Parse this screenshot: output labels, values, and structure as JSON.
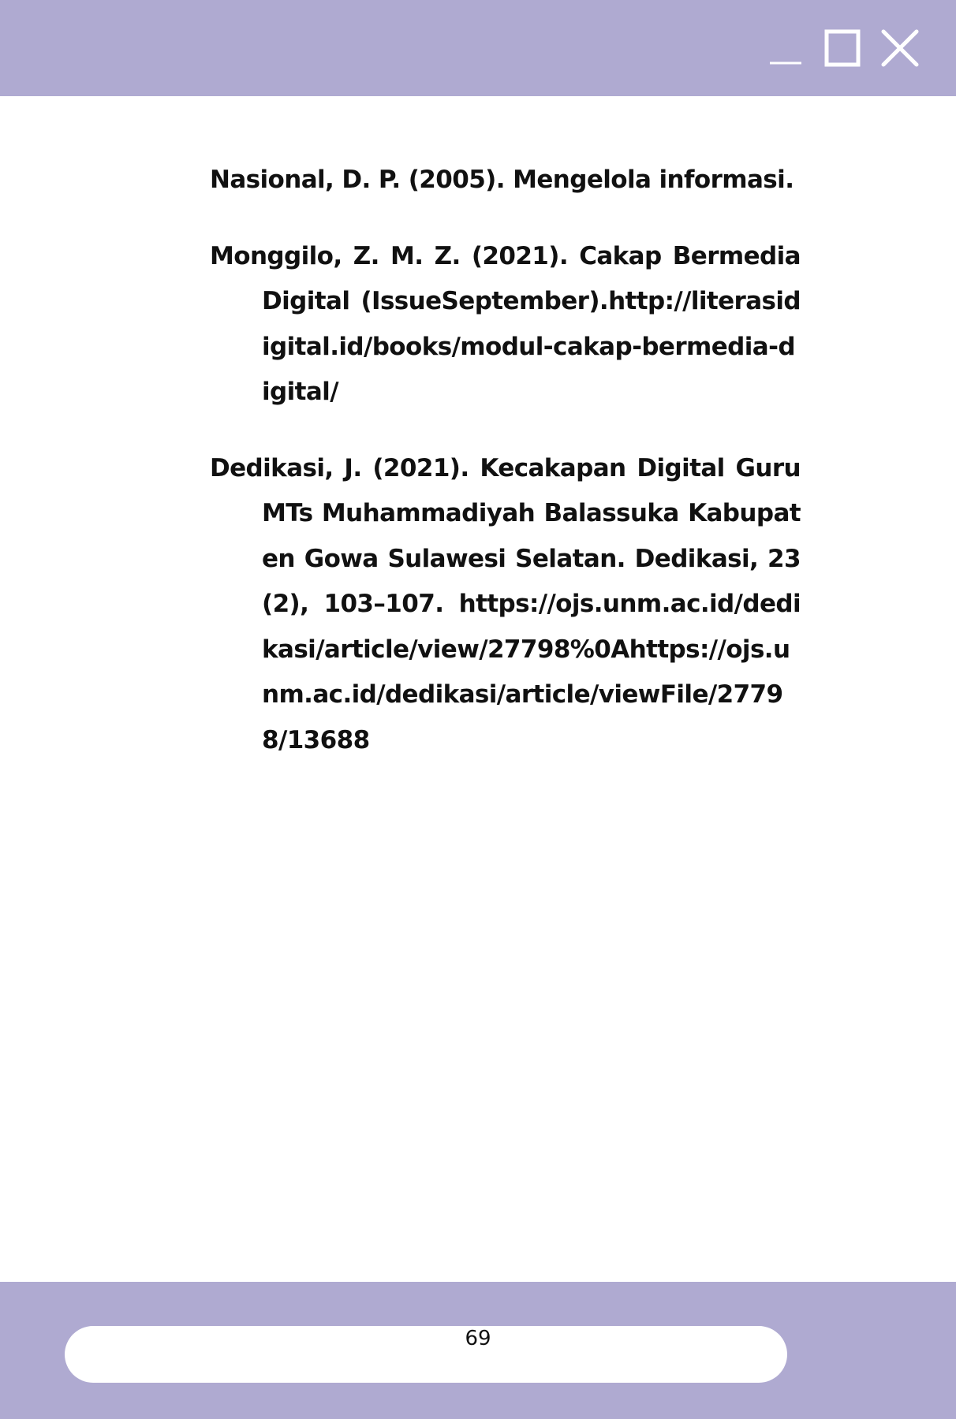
{
  "window": {
    "controls": {
      "minimize": "minimize-icon",
      "maximize": "maximize-icon",
      "close": "close-icon"
    },
    "accent_color": "#afaad1"
  },
  "references": [
    "Nasional, D. P. (2005). Mengelola informasi.",
    "Monggilo, Z. M. Z. (2021). Cakap Bermedia Digital (IssueSeptember).http://literasidigital.id/books/modul-cakap-bermedia-digital/",
    "Dedikasi, J. (2021). Kecakapan Digital Guru MTs Muhammadiyah Balassuka Kabupaten Gowa Sulawesi Selatan. Dedikasi, 23(2), 103–107. https://ojs.unm.ac.id/dedikasi/article/view/27798%0Ahttps://ojs.unm.ac.id/dedikasi/article/viewFile/27798/13688"
  ],
  "footer": {
    "page_number": "69"
  }
}
